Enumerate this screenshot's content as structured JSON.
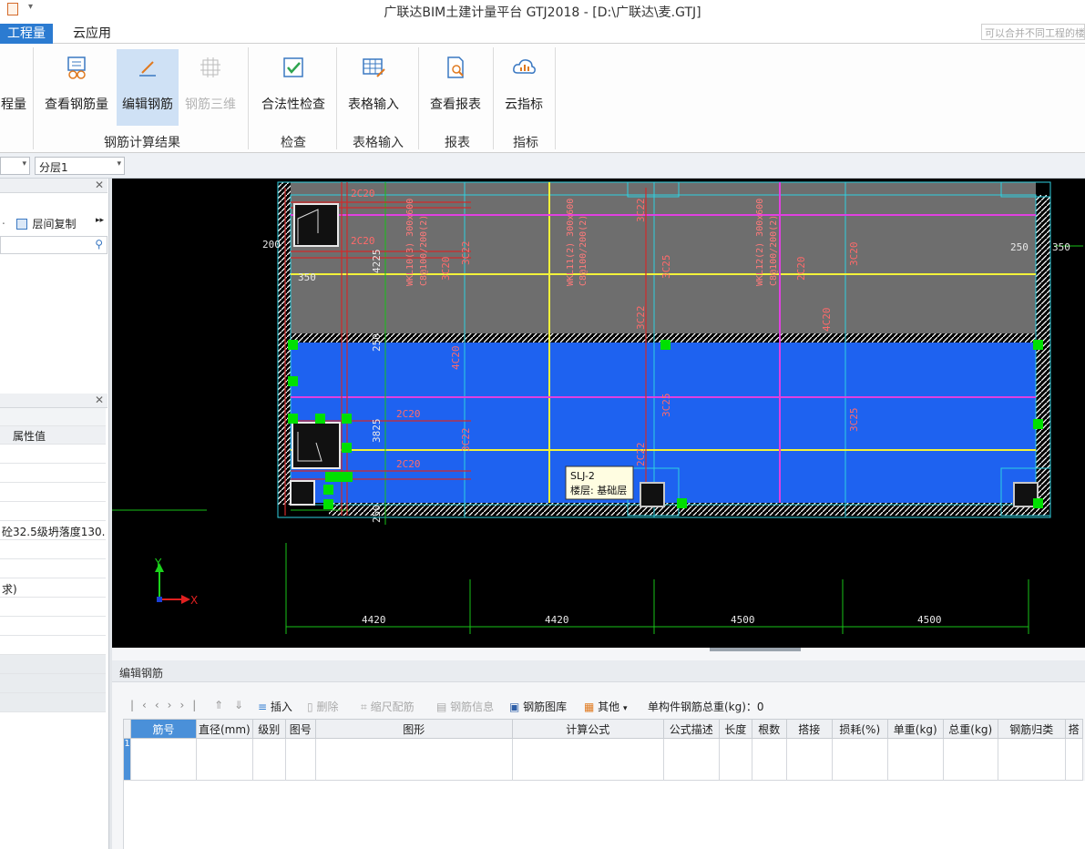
{
  "window": {
    "title": "广联达BIM土建计量平台 GTJ2018 - [D:\\广联达\\麦.GTJ]"
  },
  "menu": {
    "tabs": [
      {
        "label": "工程量",
        "active": true
      },
      {
        "label": "云应用",
        "active": false
      }
    ],
    "search_placeholder": "可以合并不同工程的楼"
  },
  "ribbon": {
    "buttons": [
      {
        "label": "程量",
        "icon": "quantity-icon"
      },
      {
        "label": "查看钢筋量",
        "icon": "view-rebar-icon"
      },
      {
        "label": "编辑钢筋",
        "icon": "edit-rebar-icon",
        "selected": true
      },
      {
        "label": "钢筋三维",
        "icon": "rebar-3d-icon",
        "disabled": true
      },
      {
        "label": "合法性检查",
        "icon": "check-icon"
      },
      {
        "label": "表格输入",
        "icon": "table-input-icon"
      },
      {
        "label": "查看报表",
        "icon": "report-icon"
      },
      {
        "label": "云指标",
        "icon": "cloud-index-icon"
      }
    ],
    "groups": [
      "钢筋计算结果",
      "检查",
      "表格输入",
      "报表",
      "指标"
    ]
  },
  "floorbar": {
    "floor_value": "",
    "layer_value": "分层1"
  },
  "left_panel": {
    "copy_label": "层间复制",
    "props_header": "属性值",
    "row_concrete": "砼32.5级坍落度130...",
    "row_paren": "求)"
  },
  "canvas": {
    "dim_labels": [
      "4420",
      "4420",
      "4500",
      "4500"
    ],
    "side_labels": [
      "200",
      "250",
      "350",
      "350",
      "4225",
      "3825",
      "250",
      "250"
    ],
    "rebar_labels": [
      "2C20",
      "2C20",
      "2C20",
      "2C20",
      "3C22",
      "3C22",
      "3C22",
      "3C25",
      "3C25",
      "3C20",
      "4C20",
      "4C20",
      "3C20",
      "3C22",
      "3C25",
      "2C22",
      "2C20"
    ],
    "beam_labels": [
      "WKL10(3) 300x600",
      "C8@100/200(2)",
      "WKL11(2) 300x600",
      "C8@100/200(2)",
      "WKL12(2) 300x600",
      "C8@100/200(2)"
    ],
    "tooltip_line1": "SLJ-2",
    "tooltip_line2": "楼层: 基础层",
    "axis_x": "X",
    "axis_y": "Y",
    "colors": {
      "background": "#000000",
      "slab_fill": "#1e62f0",
      "upper_fill": "#6e6e6e",
      "beam_yellow": "#f2f23a",
      "beam_magenta": "#e040e0",
      "grip_green": "#00e000"
    }
  },
  "editor": {
    "title": "编辑钢筋",
    "toolbar": {
      "insert": "插入",
      "delete": "删除",
      "scale": "缩尺配筋",
      "rebar_info": "钢筋信息",
      "rebar_lib": "钢筋图库",
      "other": "其他",
      "total_weight": "单构件钢筋总重(kg)：0"
    },
    "columns": [
      "筋号",
      "直径(mm)",
      "级别",
      "图号",
      "图形",
      "计算公式",
      "公式描述",
      "长度",
      "根数",
      "搭接",
      "损耗(%)",
      "单重(kg)",
      "总重(kg)",
      "钢筋归类",
      "搭"
    ],
    "row_number": "1"
  }
}
